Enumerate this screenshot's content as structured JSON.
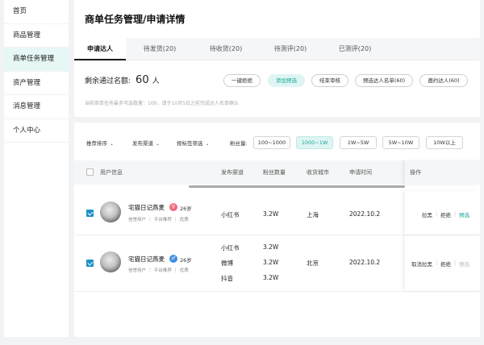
{
  "sidebar": {
    "items": [
      {
        "label": "首页"
      },
      {
        "label": "商品管理"
      },
      {
        "label": "商单任务管理"
      },
      {
        "label": "资产管理"
      },
      {
        "label": "消息管理"
      },
      {
        "label": "个人中心"
      }
    ]
  },
  "header": {
    "title": "商单任务管理/申请详情",
    "tabs": [
      {
        "label": "申请达人"
      },
      {
        "label": "待发货(20)"
      },
      {
        "label": "待收货(20)"
      },
      {
        "label": "待测评(20)"
      },
      {
        "label": "已测评(20)"
      }
    ],
    "quota_label": "剩余通过名额:",
    "quota_value": "60",
    "quota_unit": "人",
    "hint": "当前商单任务最多可选数量：100，请于10月5日之前完成达人名单确认",
    "actions": [
      {
        "label": "一键拒绝"
      },
      {
        "label": "添加预选"
      },
      {
        "label": "结束审核"
      },
      {
        "label": "预选达人名单(60)"
      },
      {
        "label": "邀约达人(60)"
      }
    ]
  },
  "filters": {
    "sort": "推荐排序",
    "channel": "发布渠道",
    "tag": "按标签筛选",
    "fans_label": "粉丝量:",
    "ranges": [
      {
        "label": "100~1000"
      },
      {
        "label": "1000~1W"
      },
      {
        "label": "1W~5W"
      },
      {
        "label": "5W~10W"
      },
      {
        "label": "10W以上"
      }
    ]
  },
  "table": {
    "headers": {
      "user": "用户信息",
      "channel": "发布渠道",
      "fans": "粉丝数量",
      "city": "收货城市",
      "time": "申请时间",
      "ops": "操作"
    },
    "rows": [
      {
        "name": "宅猫日记燕麦",
        "gender_symbol": "♀",
        "age": "26岁",
        "tags": [
          "信誉用户",
          "平台推荐",
          "优质"
        ],
        "channels": [
          "小红书"
        ],
        "fans": [
          "3.2W"
        ],
        "city": "上海",
        "time": "2022.10.2",
        "ops": [
          "拉黑",
          "拒绝",
          "预选"
        ]
      },
      {
        "name": "宅猫日记燕麦",
        "gender_symbol": "♂",
        "age": "26岁",
        "tags": [
          "信誉用户",
          "平台推荐",
          "优质"
        ],
        "channels": [
          "小红书",
          "微博",
          "抖音"
        ],
        "fans": [
          "3.2W",
          "3.2W",
          "3.2W"
        ],
        "city": "北京",
        "time": "2022.10.2",
        "ops": [
          "取消拉黑",
          "拒绝",
          "预选"
        ]
      }
    ]
  },
  "colors": {
    "accent": "#1aa89a",
    "accent_bg": "#dff5f3",
    "checkbox": "#1e90c6"
  }
}
